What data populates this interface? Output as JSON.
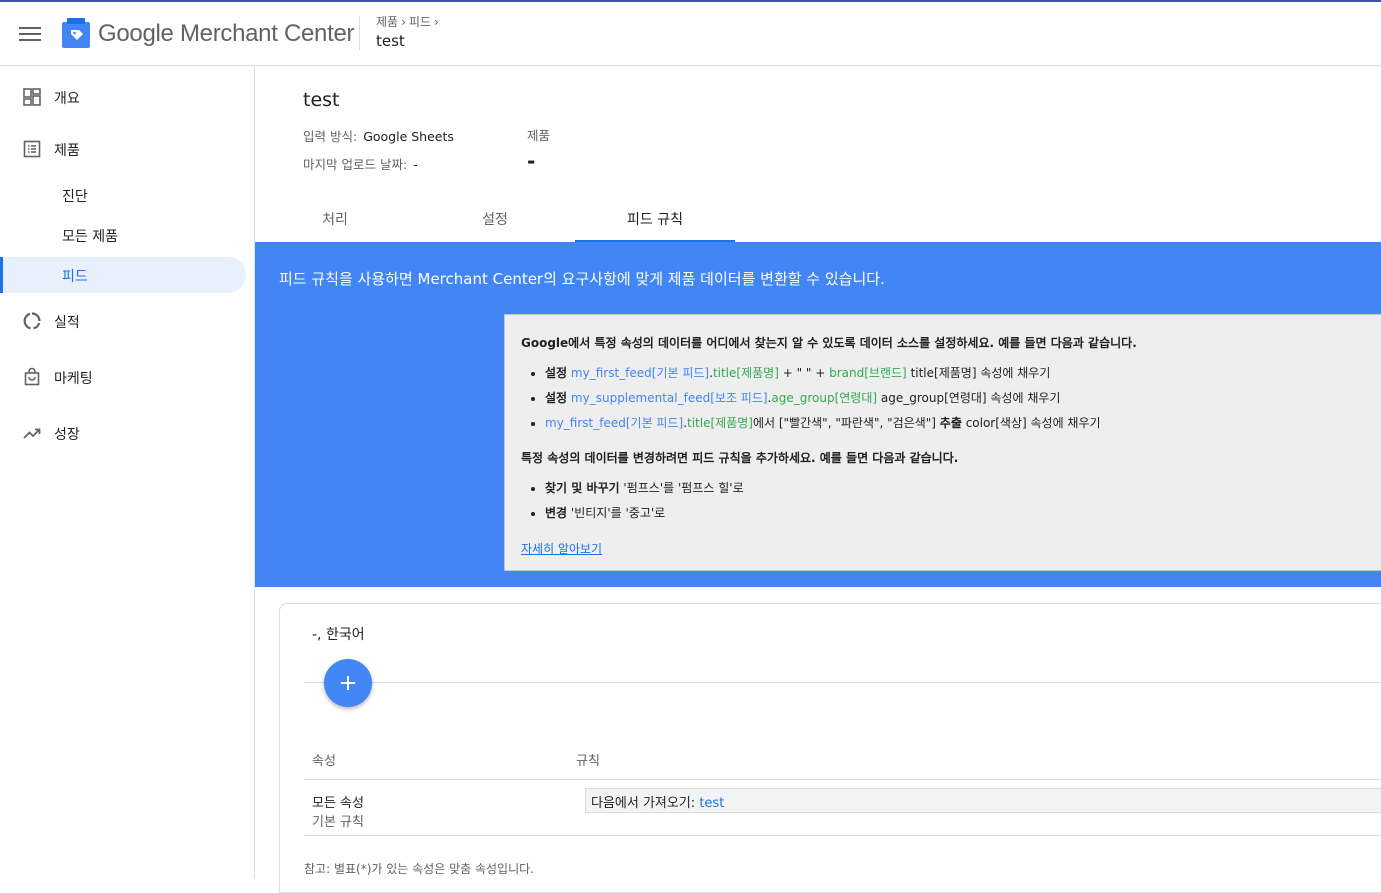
{
  "header": {
    "app_name": "Google Merchant Center",
    "breadcrumb": [
      "제품",
      "피드"
    ],
    "title": "test"
  },
  "sidebar": {
    "items": [
      {
        "label": "개요",
        "icon": "dashboard-icon"
      },
      {
        "label": "제품",
        "icon": "list-icon"
      },
      {
        "label": "진단"
      },
      {
        "label": "모든 제품"
      },
      {
        "label": "피드",
        "active": true
      },
      {
        "label": "실적",
        "icon": "donut-chart-icon"
      },
      {
        "label": "마케팅",
        "icon": "shopping-bag-icon"
      },
      {
        "label": "성장",
        "icon": "trending-up-icon"
      }
    ]
  },
  "feed": {
    "title": "test",
    "input_method_label": "입력 방식:",
    "input_method_value": "Google Sheets",
    "last_upload_label": "마지막 업로드 날짜:",
    "last_upload_value": "-",
    "products_label": "제품",
    "products_value": "-"
  },
  "tabs": [
    {
      "label": "처리"
    },
    {
      "label": "설정"
    },
    {
      "label": "피드 규칙",
      "active": true
    }
  ],
  "banner": {
    "text": "피드 규칙을 사용하면 Merchant Center의 요구사항에 맞게 제품 데이터를 변환할 수 있습니다.",
    "info_heading_1": "Google에서 특정 속성의 데이터를 어디에서 찾는지 알 수 있도록 데이터 소스를 설정하세요. 예를 들면 다음과 같습니다.",
    "examples_1": [
      {
        "b": "설정",
        "p1": "my_first_feed[기본 피드]",
        "dot": ".",
        "p2": "title[제품명]",
        "mid": " + \" \" + ",
        "p3": "brand[브랜드]",
        "rest": " title[제품명] 속성에 채우기"
      },
      {
        "b": "설정",
        "p1": "my_supplemental_feed[보조 피드]",
        "dot": ".",
        "p2": "age_group[연령대]",
        "rest": " age_group[연령대] 속성에 채우기"
      },
      {
        "p1": "my_first_feed[기본 피드]",
        "dot": ".",
        "p2": "title[제품명]",
        "mid": "에서 [\"빨간색\", \"파란색\", \"검은색\"] ",
        "b2": "추출",
        "rest": " color[색상] 속성에 채우기"
      }
    ],
    "info_heading_2": "특정 속성의 데이터를 변경하려면 피드 규칙을 추가하세요. 예를 들면 다음과 같습니다.",
    "examples_2": [
      {
        "b": "찾기 및 바꾸기",
        "rest": " '펌프스'를 '펌프스 힐'로"
      },
      {
        "b": "변경",
        "rest": " '빈티지'를 '중고'로"
      }
    ],
    "learn_more": "자세히 알아보기"
  },
  "rules_card": {
    "title": "-, 한국어",
    "col_attribute": "속성",
    "col_rule": "규칙",
    "row_name": "모든 속성",
    "row_sub": "기본 규칙",
    "rule_prefix": "다음에서 가져오기: ",
    "rule_source": "test",
    "note": "참고: 별표(*)가 있는 속성은 맞춤 속성입니다."
  },
  "colors": {
    "banner": "#4285f4",
    "accent": "#1a73e8",
    "green": "#34a853"
  }
}
